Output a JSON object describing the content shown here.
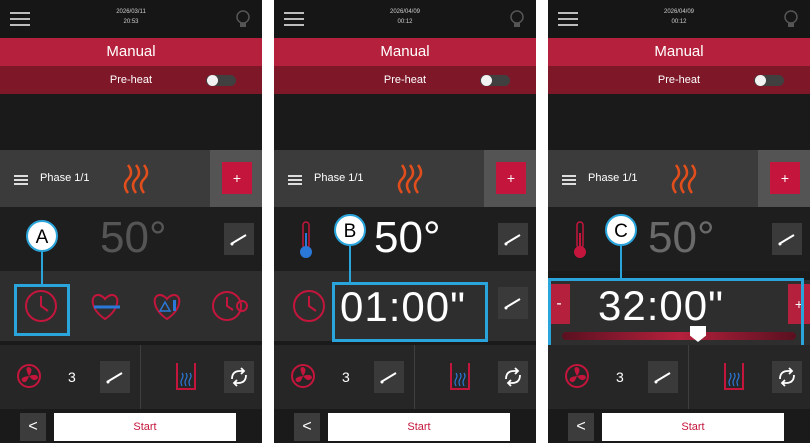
{
  "panels": [
    {
      "date": "2026/03/11",
      "time": "20:53",
      "mode": "Manual",
      "preheat_label": "Pre-heat",
      "phase_label": "Phase 1/1",
      "plus_label": "+",
      "temperature": "50°",
      "fan_speed": "3",
      "start_label": "Start",
      "back_label": "<",
      "callout": "A"
    },
    {
      "date": "2026/04/09",
      "time": "00:12",
      "mode": "Manual",
      "preheat_label": "Pre-heat",
      "phase_label": "Phase 1/1",
      "plus_label": "+",
      "temperature": "50°",
      "time_value": "01:00\"",
      "fan_speed": "3",
      "start_label": "Start",
      "back_label": "<",
      "callout": "B"
    },
    {
      "date": "2026/04/09",
      "time": "00:12",
      "mode": "Manual",
      "preheat_label": "Pre-heat",
      "phase_label": "Phase 1/1",
      "plus_label": "+",
      "temperature": "50°",
      "time_value": "32:00\"",
      "minus_label": "-",
      "fan_speed": "3",
      "start_label": "Start",
      "back_label": "<",
      "callout": "C"
    }
  ],
  "colors": {
    "accent": "#b5213c",
    "highlight": "#2aa5dc",
    "background": "#1a1a1a"
  },
  "icons": [
    "menu-icon",
    "bulb-icon",
    "list-icon",
    "heat-waves-icon",
    "thermometer-icon",
    "clock-icon",
    "heart-probe-icon",
    "delta-probe-icon",
    "cook-hold-icon",
    "fan-icon",
    "vent-icon",
    "cycle-icon",
    "edit-icon"
  ]
}
